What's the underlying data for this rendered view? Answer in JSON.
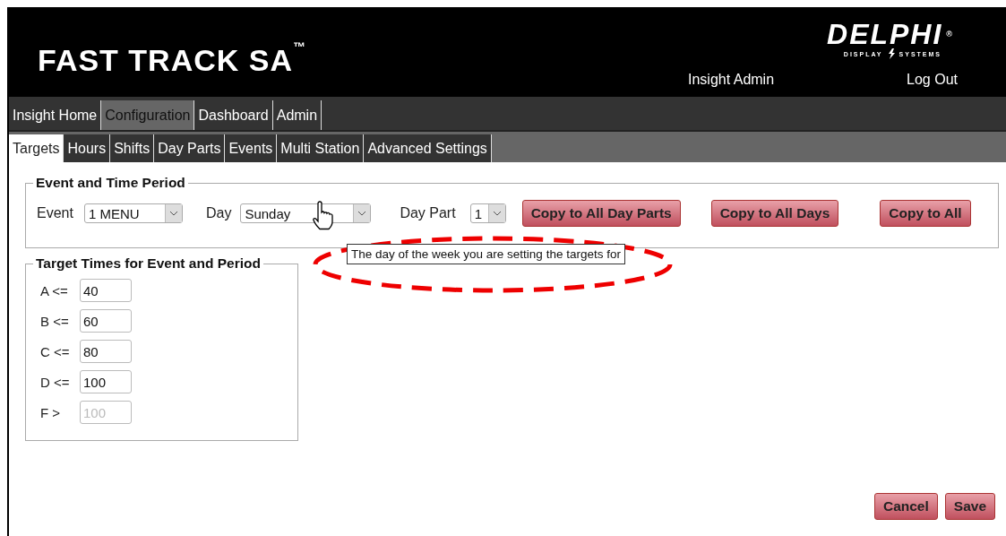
{
  "header": {
    "product": "FAST TRACK SA",
    "product_mark": "™",
    "brand": "DELPHI",
    "brand_mark": "®",
    "brand_sub_left": "DISPLAY",
    "brand_sub_right": "SYSTEMS",
    "user": "Insight Admin",
    "logout": "Log Out"
  },
  "main_nav": [
    {
      "label": "Insight Home",
      "selected": false
    },
    {
      "label": "Configuration",
      "selected": true
    },
    {
      "label": "Dashboard",
      "selected": false
    },
    {
      "label": "Admin",
      "selected": false
    }
  ],
  "sub_tabs": [
    {
      "label": "Targets",
      "selected": true
    },
    {
      "label": "Hours",
      "selected": false
    },
    {
      "label": "Shifts",
      "selected": false
    },
    {
      "label": "Day Parts",
      "selected": false
    },
    {
      "label": "Events",
      "selected": false
    },
    {
      "label": "Multi Station",
      "selected": false
    },
    {
      "label": "Advanced Settings",
      "selected": false
    }
  ],
  "event_period": {
    "legend": "Event and Time Period",
    "event_label": "Event",
    "event_value": "1 MENU",
    "day_label": "Day",
    "day_value": "Sunday",
    "day_part_label": "Day Part",
    "day_part_value": "1",
    "buttons": [
      "Copy to All Day Parts",
      "Copy to All Days",
      "Copy to All"
    ]
  },
  "tooltip": "The day of the week you are setting the targets for",
  "targets": {
    "legend": "Target Times for Event and Period",
    "rows": [
      {
        "label": "A <=",
        "value": "40",
        "disabled": false
      },
      {
        "label": "B <=",
        "value": "60",
        "disabled": false
      },
      {
        "label": "C <=",
        "value": "80",
        "disabled": false
      },
      {
        "label": "D <=",
        "value": "100",
        "disabled": false
      },
      {
        "label": "F >",
        "value": "100",
        "disabled": true
      }
    ]
  },
  "footer_buttons": [
    "Cancel",
    "Save"
  ]
}
